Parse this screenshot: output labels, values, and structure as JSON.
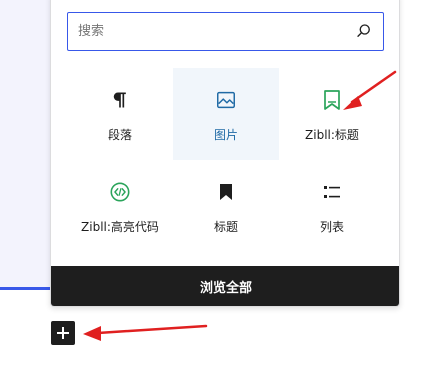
{
  "search": {
    "placeholder": "搜索",
    "value": ""
  },
  "blocks": [
    {
      "label": "段落",
      "icon": "paragraph-icon"
    },
    {
      "label": "图片",
      "icon": "image-icon",
      "selected": true,
      "color": "#1f6aa5"
    },
    {
      "label": "Zibll:标题",
      "icon": "bookmark-outline-icon",
      "color": "#2ba45b"
    },
    {
      "label": "Zibll:高亮代码",
      "icon": "code-icon",
      "color": "#2ba45b"
    },
    {
      "label": "标题",
      "icon": "bookmark-icon"
    },
    {
      "label": "列表",
      "icon": "list-icon"
    }
  ],
  "browse_all_label": "浏览全部",
  "colors": {
    "accent": "#3858e9",
    "dark": "#1e1e1e",
    "annotation": "#e02020"
  }
}
